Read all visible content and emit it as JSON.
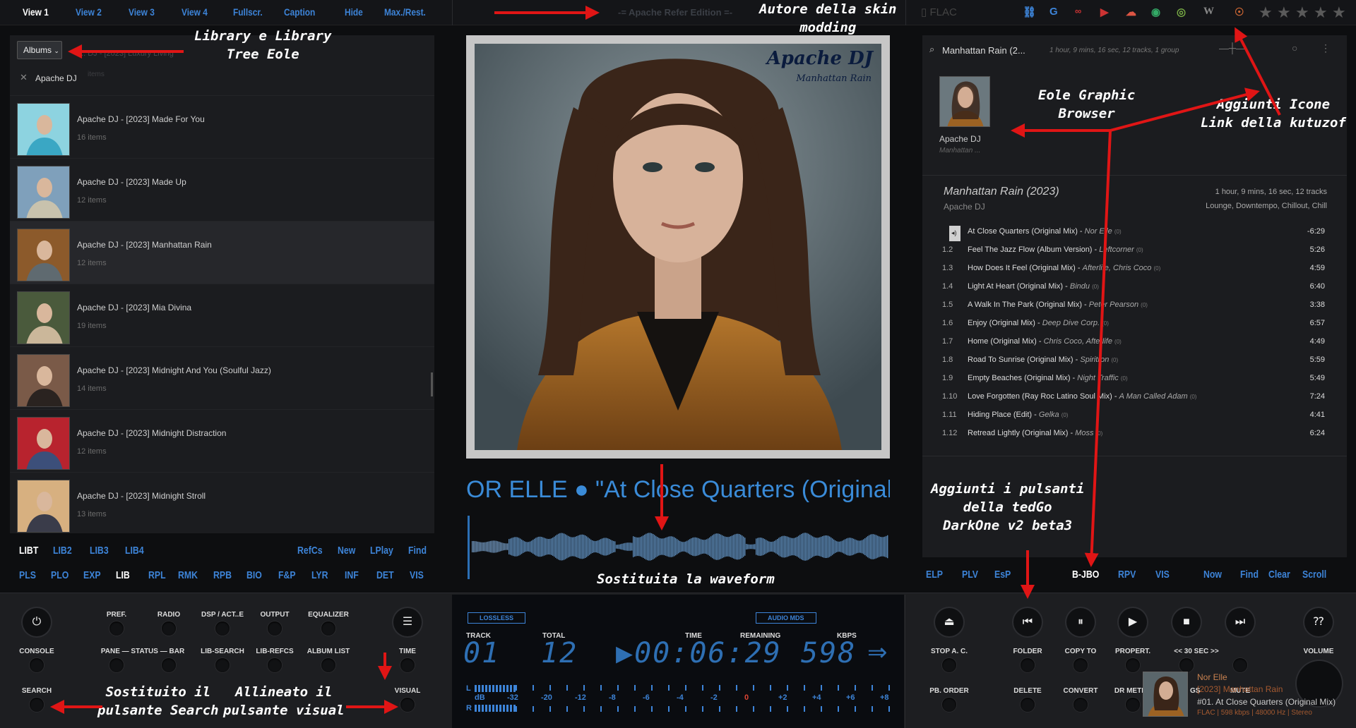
{
  "topbar": {
    "views": [
      "View 1",
      "View 2",
      "View 3",
      "View 4",
      "Fullscr.",
      "Caption",
      "Hide",
      "Max./Rest."
    ],
    "edition": "-= Apache Refer Edition =-",
    "format": "FLAC",
    "link_icons": [
      "link-icon",
      "google-icon",
      "lastfm-icon",
      "youtube-icon",
      "soundcloud-icon",
      "spotify-icon",
      "discogs-icon",
      "wikipedia-icon",
      "podcast-icon"
    ],
    "rating_stars": 5
  },
  "library": {
    "view_select": "Albums",
    "ghost_text": "... DJ - [2023] Luxury Living",
    "search_value": "Apache DJ",
    "ghost_items": "items",
    "albums": [
      {
        "title": "Apache DJ - [2023] Made For You",
        "count": "16 items"
      },
      {
        "title": "Apache DJ - [2023] Made Up",
        "count": "12 items"
      },
      {
        "title": "Apache DJ - [2023] Manhattan Rain",
        "count": "12 items",
        "selected": true
      },
      {
        "title": "Apache DJ - [2023] Mia Divina",
        "count": "19 items"
      },
      {
        "title": "Apache DJ - [2023] Midnight And You (Soulful Jazz)",
        "count": "14 items"
      },
      {
        "title": "Apache DJ - [2023] Midnight Distraction",
        "count": "12 items"
      },
      {
        "title": "Apache DJ - [2023] Midnight Stroll",
        "count": "13 items"
      }
    ],
    "nav_row1_left": [
      "LIBT",
      "LIB2",
      "LIB3",
      "LIB4"
    ],
    "nav_row1_right": [
      "RefCs",
      "New",
      "LPlay",
      "Find"
    ],
    "nav_row2": [
      "PLS",
      "PLO",
      "EXP",
      "LIB",
      "RPL",
      "RMK",
      "RPB",
      "BIO",
      "F&P",
      "LYR",
      "INF",
      "DET",
      "VIS"
    ]
  },
  "cover": {
    "artist": "Apache DJ",
    "album": "Manhattan Rain"
  },
  "now_playing_scroll": "OR ELLE ● \"At Close Quarters (Original",
  "browser": {
    "search": "Manhattan Rain (2...",
    "meta": "1 hour, 9 mins, 16 sec,   12 tracks,   1 group",
    "tile_artist": "Apache DJ",
    "tile_album": "Manhattan ...",
    "header_title": "Manhattan Rain (2023)",
    "header_artist": "Apache DJ",
    "header_duration": "1 hour, 9 mins, 16 sec,  12 tracks",
    "header_genres": "Lounge, Downtempo, Chillout, Chill",
    "tracks": [
      {
        "num": "",
        "title": "At Close Quarters (Original Mix)",
        "artist": "Nor Elle",
        "count": "(0)",
        "dur": "-6:29",
        "playing": true
      },
      {
        "num": "1.2",
        "title": "Feel The Jazz Flow (Album Version)",
        "artist": "Leftcorner",
        "count": "(0)",
        "dur": "5:26"
      },
      {
        "num": "1.3",
        "title": "How Does It Feel (Original Mix)",
        "artist": "Afterlife, Chris Coco",
        "count": "(0)",
        "dur": "4:59"
      },
      {
        "num": "1.4",
        "title": "Light At Heart (Original Mix)",
        "artist": "Bindu",
        "count": "(0)",
        "dur": "6:40"
      },
      {
        "num": "1.5",
        "title": "A Walk In The Park (Original Mix)",
        "artist": "Peter Pearson",
        "count": "(0)",
        "dur": "3:38"
      },
      {
        "num": "1.6",
        "title": "Enjoy (Original Mix)",
        "artist": "Deep Dive Corp.",
        "count": "(0)",
        "dur": "6:57"
      },
      {
        "num": "1.7",
        "title": "Home (Original Mix)",
        "artist": "Chris Coco, Afterlife",
        "count": "(0)",
        "dur": "4:49"
      },
      {
        "num": "1.8",
        "title": "Road To Sunrise (Original Mix)",
        "artist": "Spiritron",
        "count": "(0)",
        "dur": "5:59"
      },
      {
        "num": "1.9",
        "title": "Empty Beaches (Original Mix)",
        "artist": "Night Traffic",
        "count": "(0)",
        "dur": "5:49"
      },
      {
        "num": "1.10",
        "title": "Love Forgotten (Ray Roc Latino Soul Mix)",
        "artist": "A Man Called Adam",
        "count": "(0)",
        "dur": "7:24"
      },
      {
        "num": "1.11",
        "title": "Hiding Place (Edit)",
        "artist": "Gelka",
        "count": "(0)",
        "dur": "4:41"
      },
      {
        "num": "1.12",
        "title": "Retread Lightly (Original Mix)",
        "artist": "Moss",
        "count": "(0)",
        "dur": "6:24"
      }
    ],
    "nav_left": [
      "ELP",
      "PLV",
      "EsP"
    ],
    "nav_active": "B-JBO",
    "nav_mid": [
      "RPV",
      "VIS"
    ],
    "nav_right": [
      "Now",
      "Find",
      "Clear",
      "Scroll"
    ]
  },
  "bottom_left": {
    "row1": [
      "PREF.",
      "RADIO",
      "DSP / ACT..E",
      "OUTPUT",
      "EQUALIZER"
    ],
    "row2": [
      "CONSOLE",
      "PANE — STATUS — BAR",
      "LIB-SEARCH",
      "LIB-REFCS",
      "ALBUM LIST",
      "TIME"
    ],
    "row3": [
      "SEARCH",
      "VISUAL"
    ]
  },
  "display": {
    "lossless": "LOSSLESS",
    "audio_mode": "AUDIO MDS",
    "track_label": "TRACK",
    "track": "01",
    "total_label": "TOTAL",
    "total": "12",
    "time_label": "TIME",
    "remaining_label": "REMAINING",
    "time": "▶00:06:29",
    "kbps_label": "KBPS",
    "kbps": "598",
    "db_label": "dB",
    "vu_scale": [
      "-32",
      "-20",
      "-12",
      "-8",
      "-6",
      "-4",
      "-2",
      "0",
      "+2",
      "+4",
      "+6",
      "+8"
    ]
  },
  "bottom_right": {
    "row_labels": [
      "STOP A. C.",
      "FOLDER",
      "COPY TO",
      "PROPERT.",
      "VOLUME"
    ],
    "row3_labels": [
      "PB. ORDER",
      "DELETE",
      "CONVERT",
      "DR METER",
      "DISCO GS",
      "MUTE"
    ],
    "sec_label": "<<  30  SEC  >>",
    "mini_artist": "Nor Elle",
    "mini_album": "[2023] Manhattan Rain",
    "mini_track": "#01. At Close Quarters (Original Mix)",
    "mini_tech": "FLAC | 598 kbps | 48000 Hz | Stereo"
  },
  "annotations": {
    "autore": "Autore della skin\nmodding",
    "library": "Library e Library\nTree Eole",
    "browser": "Eole Graphic\nBrowser",
    "icone": "Aggiunti Icone\nLink della kutuzof",
    "tedgo": "Aggiunti i pulsanti\ndella tedGo\nDarkOne v2 beta3",
    "waveform": "Sostituita la waveform",
    "search": "Sostituito il\npulsante Search",
    "visual": "Allineato il\npulsante visual"
  }
}
